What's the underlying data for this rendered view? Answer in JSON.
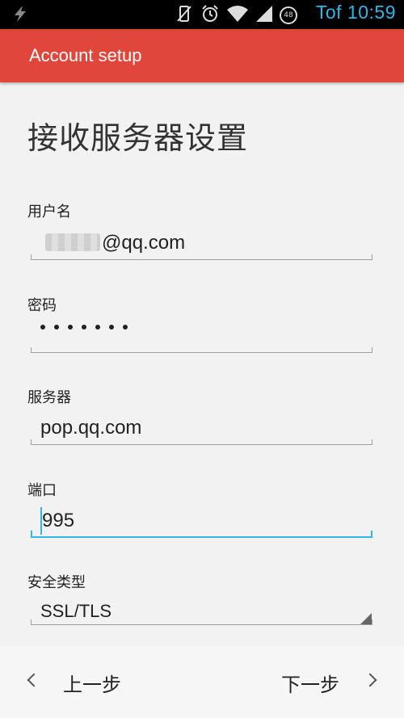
{
  "status_bar": {
    "time": "Tof 10:59",
    "battery_badge": "48",
    "icons": [
      "charging-bolt-icon",
      "vibrate-off-icon",
      "alarm-icon",
      "wifi-icon",
      "signal-icon",
      "battery-icon"
    ]
  },
  "action_bar": {
    "title": "Account setup"
  },
  "page": {
    "title": "接收服务器设置"
  },
  "form": {
    "username": {
      "label": "用户名",
      "value": "@qq.com"
    },
    "password": {
      "label": "密码",
      "dot_count": 7
    },
    "server": {
      "label": "服务器",
      "value": "pop.qq.com"
    },
    "port": {
      "label": "端口",
      "value": "995"
    },
    "security": {
      "label": "安全类型",
      "value": "SSL/TLS"
    }
  },
  "nav": {
    "previous_label": "上一步",
    "next_label": "下一步"
  },
  "colors": {
    "accent": "#33b5e5",
    "action_bar": "#e0463a"
  }
}
